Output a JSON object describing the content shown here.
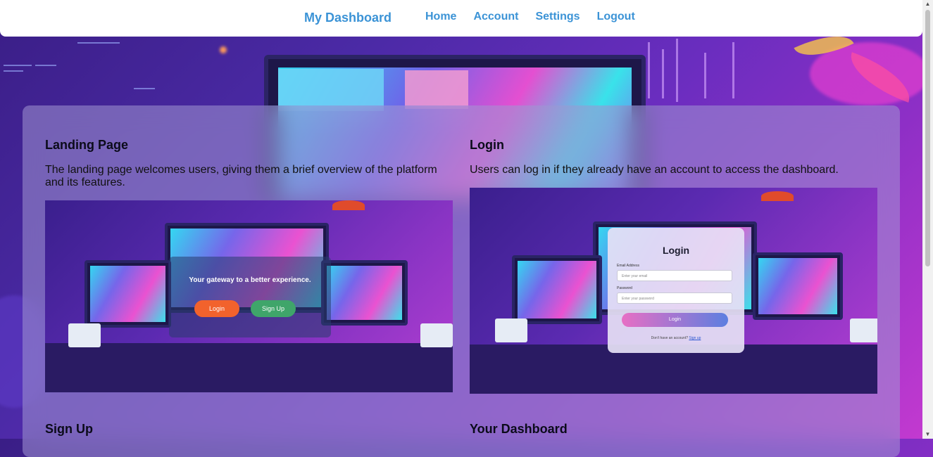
{
  "header": {
    "brand": "My Dashboard",
    "nav": [
      "Home",
      "Account",
      "Settings",
      "Logout"
    ]
  },
  "cards": [
    {
      "title": "Landing Page",
      "description": "The landing page welcomes users, giving them a brief overview of the platform and its features.",
      "preview": {
        "tagline": "Your gateway to a better experience.",
        "login_label": "Login",
        "signup_label": "Sign Up"
      }
    },
    {
      "title": "Login",
      "description": "Users can log in if they already have an account to access the dashboard.",
      "preview": {
        "heading": "Login",
        "email_label": "Email Address",
        "email_placeholder": "Enter your email",
        "password_label": "Password",
        "password_placeholder": "Enter your password",
        "submit_label": "Login",
        "footer_text": "Don't have an account?",
        "footer_link": "Sign up"
      }
    },
    {
      "title": "Sign Up"
    },
    {
      "title": "Your Dashboard"
    }
  ],
  "colors": {
    "nav_link": "#3b93d6",
    "login_button": "#f2622c",
    "signup_button": "#3fa56a"
  }
}
